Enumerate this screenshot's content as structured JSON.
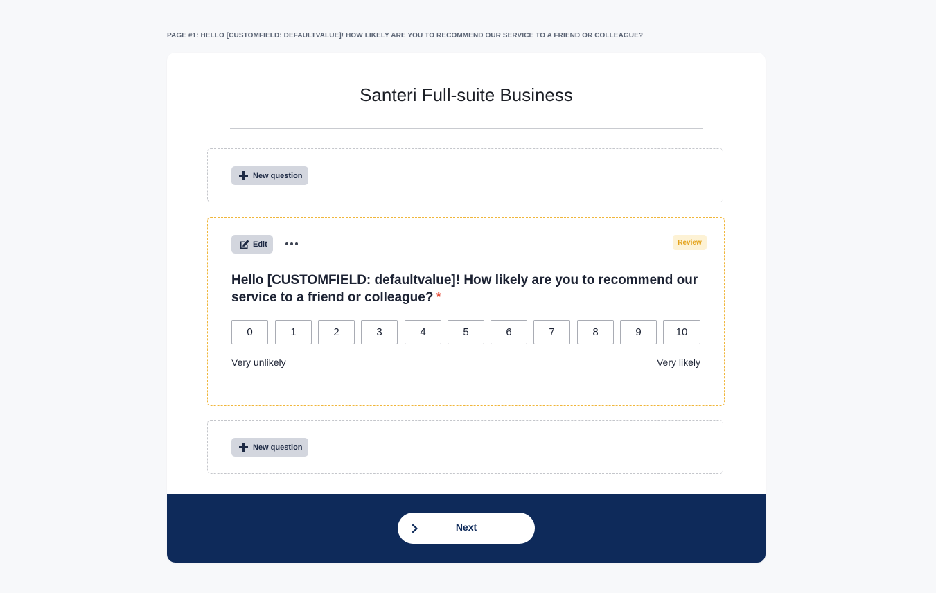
{
  "page": {
    "label": "PAGE #1: HELLO [CUSTOMFIELD: DEFAULTVALUE]! HOW LIKELY ARE YOU TO RECOMMEND OUR SERVICE TO A FRIEND OR COLLEAGUE?"
  },
  "survey": {
    "title": "Santeri Full-suite Business"
  },
  "new_question": {
    "label": "New question",
    "icon": "plus-icon"
  },
  "question": {
    "edit_label": "Edit",
    "edit_icon": "edit-icon",
    "more_icon": "more-horizontal-icon",
    "badge": "Review",
    "text": "Hello [CUSTOMFIELD: defaultvalue]! How likely are you to recommend our service to a friend or colleague?",
    "required_mark": "*",
    "scale": [
      "0",
      "1",
      "2",
      "3",
      "4",
      "5",
      "6",
      "7",
      "8",
      "9",
      "10"
    ],
    "low_label": "Very unlikely",
    "high_label": "Very likely"
  },
  "footer": {
    "next_label": "Next",
    "next_icon": "chevron-right-icon"
  },
  "colors": {
    "footer_bg": "#0e2a5a",
    "review_text": "#e3a21a",
    "review_bg": "#fdf2d5",
    "required": "#e6513d",
    "active_border": "#f0b63b"
  }
}
